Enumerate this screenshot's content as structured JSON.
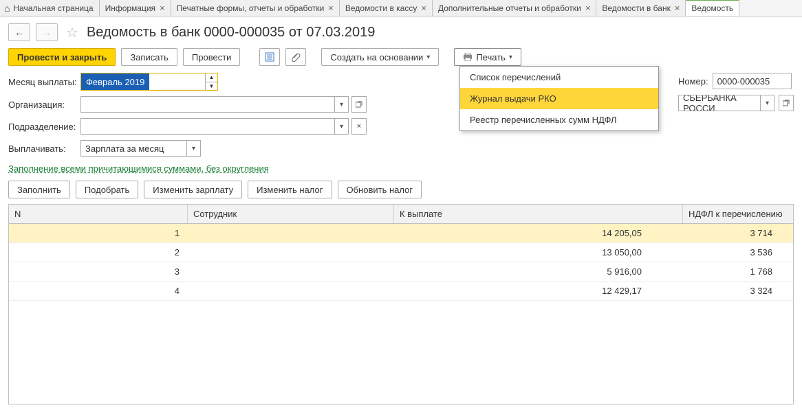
{
  "tabs": [
    {
      "label": "Начальная страница",
      "closable": false,
      "home": true
    },
    {
      "label": "Информация",
      "closable": true
    },
    {
      "label": "Печатные формы, отчеты и обработки",
      "closable": true
    },
    {
      "label": "Ведомости в кассу",
      "closable": true
    },
    {
      "label": "Дополнительные отчеты и обработки",
      "closable": true
    },
    {
      "label": "Ведомости в банк",
      "closable": true
    },
    {
      "label": "Ведомость",
      "closable": false,
      "active": true
    }
  ],
  "title": "Ведомость в банк 0000-000035 от 07.03.2019",
  "toolbar": {
    "submit_close": "Провести и закрыть",
    "save": "Записать",
    "submit": "Провести",
    "create_based": "Создать на основании",
    "print": "Печать"
  },
  "print_menu": {
    "item1": "Список перечислений",
    "item2": "Журнал выдачи РКО",
    "item3": "Реестр перечисленных сумм НДФЛ"
  },
  "form": {
    "month_label": "Месяц выплаты:",
    "month_value": "Февраль 2019",
    "org_label": "Организация:",
    "org_value": "",
    "dept_label": "Подразделение:",
    "dept_value": "",
    "pay_label": "Выплачивать:",
    "pay_value": "Зарплата за месяц",
    "number_label": "Номер:",
    "number_value": "0000-000035",
    "bank_value": "СБЕРБАНКА РОССИ"
  },
  "fill_link": "Заполнение всеми причитающимися суммами, без округления",
  "actions": {
    "fill": "Заполнить",
    "pick": "Подобрать",
    "change_salary": "Изменить зарплату",
    "change_tax": "Изменить налог",
    "update_tax": "Обновить налог"
  },
  "grid": {
    "head": {
      "n": "N",
      "emp": "Сотрудник",
      "pay": "К выплате",
      "ndfl": "НДФЛ к перечислению"
    },
    "rows": [
      {
        "n": "1",
        "emp": "",
        "pay": "14 205,05",
        "ndfl": "3 714",
        "sel": true
      },
      {
        "n": "2",
        "emp": "",
        "pay": "13 050,00",
        "ndfl": "3 536"
      },
      {
        "n": "3",
        "emp": "",
        "pay": "5 916,00",
        "ndfl": "1 768"
      },
      {
        "n": "4",
        "emp": "",
        "pay": "12 429,17",
        "ndfl": "3 324"
      }
    ]
  }
}
